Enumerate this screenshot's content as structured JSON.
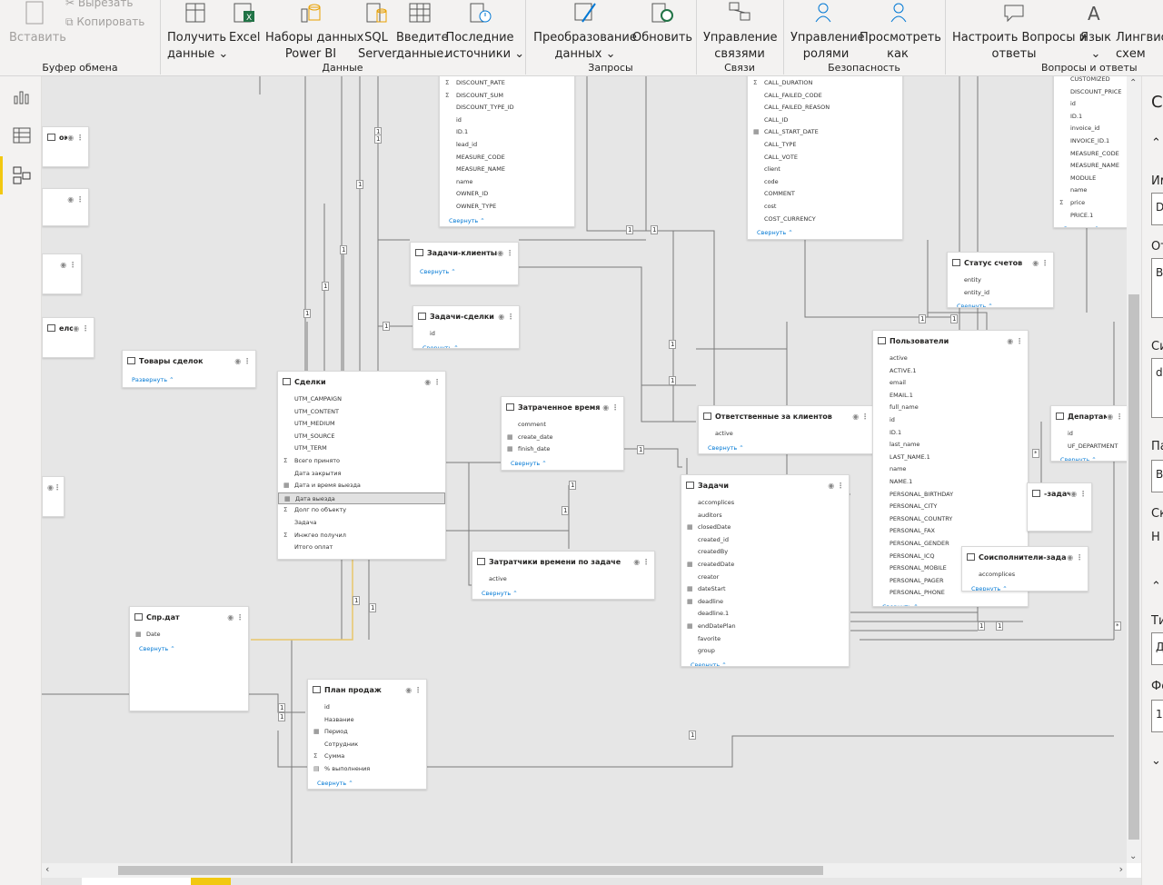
{
  "ribbon": {
    "clipboard": {
      "cut": "Вырезать",
      "copy": "Копировать",
      "paste": "Вставить",
      "group": "Буфер обмена"
    },
    "data": {
      "get_data": "Получить",
      "get_data2": "данные",
      "excel": "Excel",
      "datasets": "Наборы данных",
      "datasets2": "Power BI",
      "sql": "SQL",
      "sql2": "Server",
      "enter": "Введите",
      "enter2": "данные.",
      "recent": "Последние",
      "recent2": "источники",
      "group": "Данные"
    },
    "queries": {
      "transform": "Преобразование",
      "transform2": "данных",
      "refresh": "Обновить",
      "group": "Запросы"
    },
    "relations": {
      "manage": "Управление",
      "manage2": "связями",
      "group": "Связи"
    },
    "security": {
      "roles": "Управление",
      "roles2": "ролями",
      "view": "Просмотреть",
      "view2": "как",
      "group": "Безопасность"
    },
    "qa": {
      "setup": "Настроить Вопросы и",
      "setup2": "ответы",
      "lang": "Язык",
      "lang2": "",
      "ling": "Лингвис",
      "ling2": "схем",
      "group": "Вопросы и ответы"
    }
  },
  "tables": [
    {
      "id": "discount",
      "title": "",
      "fields": [
        "DISCOUNT_RATE",
        "DISCOUNT_SUM",
        "DISCOUNT_TYPE_ID",
        "id",
        "ID.1",
        "lead_id",
        "MEASURE_CODE",
        "MEASURE_NAME",
        "name",
        "OWNER_ID",
        "OWNER_TYPE"
      ],
      "icons": [
        "Σ",
        "Σ",
        "",
        "",
        "",
        "",
        "",
        "",
        "",
        "",
        ""
      ],
      "collapse": "Свернуть"
    },
    {
      "id": "calls",
      "title": "",
      "fields": [
        "CALL_DURATION",
        "CALL_FAILED_CODE",
        "CALL_FAILED_REASON",
        "CALL_ID",
        "CALL_START_DATE",
        "CALL_TYPE",
        "CALL_VOTE",
        "client",
        "code",
        "COMMENT",
        "cost",
        "COST_CURRENCY"
      ],
      "icons": [
        "Σ",
        "",
        "",
        "",
        "▦",
        "",
        "",
        "",
        "",
        "",
        "",
        ""
      ],
      "collapse": "Свернуть"
    },
    {
      "id": "products",
      "title": "",
      "fields": [
        "CUSTOMIZED",
        "DISCOUNT_PRICE",
        "id",
        "ID.1",
        "invoice_id",
        "INVOICE_ID.1",
        "MEASURE_CODE",
        "MEASURE_NAME",
        "MODULE",
        "name",
        "price",
        "PRICE.1"
      ],
      "icons": [
        "",
        "",
        "",
        "",
        "",
        "",
        "",
        "",
        "",
        "",
        "Σ",
        ""
      ],
      "collapse": "Свернуть"
    },
    {
      "id": "tasks_clients",
      "title": "Задачи-клиенты",
      "fields": [],
      "icons": [],
      "collapse": "Свернуть"
    },
    {
      "id": "tasks_deals",
      "title": "Задачи-сделки",
      "fields": [
        "id"
      ],
      "icons": [
        ""
      ],
      "collapse": "Свернуть"
    },
    {
      "id": "status",
      "title": "Статус счетов",
      "fields": [
        "entity",
        "entity_id"
      ],
      "icons": [
        "",
        ""
      ],
      "collapse": "Свернуть"
    },
    {
      "id": "deal_goods",
      "title": "Товары сделок",
      "fields": [],
      "icons": [],
      "collapse": "Развернуть"
    },
    {
      "id": "deals",
      "title": "Сделки",
      "fields": [
        "UTM_CAMPAIGN",
        "UTM_CONTENT",
        "UTM_MEDIUM",
        "UTM_SOURCE",
        "UTM_TERM",
        "Всего принято",
        "Дата закрытия",
        "Дата и время выезда",
        "Дата выезда",
        "Долг по объекту",
        "Задача",
        "Инжгео получил",
        "Итого оплат"
      ],
      "icons": [
        "",
        "",
        "",
        "",
        "",
        "Σ",
        "",
        "▦",
        "▦",
        "Σ",
        "",
        "Σ",
        ""
      ],
      "selected": 8,
      "collapse": "Свернуть"
    },
    {
      "id": "time_spent",
      "title": "Затраченное время",
      "fields": [
        "comment",
        "create_date",
        "finish_date"
      ],
      "icons": [
        "",
        "▦",
        "▦"
      ],
      "collapse": "Свернуть"
    },
    {
      "id": "responsible",
      "title": "Ответственные за клиентов",
      "fields": [
        "active"
      ],
      "icons": [
        ""
      ],
      "collapse": "Свернуть"
    },
    {
      "id": "users",
      "title": "Пользователи",
      "fields": [
        "active",
        "ACTIVE.1",
        "email",
        "EMAIL.1",
        "full_name",
        "id",
        "ID.1",
        "last_name",
        "LAST_NAME.1",
        "name",
        "NAME.1",
        "PERSONAL_BIRTHDAY",
        "PERSONAL_CITY",
        "PERSONAL_COUNTRY",
        "PERSONAL_FAX",
        "PERSONAL_GENDER",
        "PERSONAL_ICQ",
        "PERSONAL_MOBILE",
        "PERSONAL_PAGER",
        "PERSONAL_PHONE"
      ],
      "icons": [
        "",
        "",
        "",
        "",
        "",
        "",
        "",
        "",
        "",
        "",
        "",
        "",
        "",
        "",
        "",
        "",
        "",
        "",
        "",
        ""
      ],
      "collapse": "Свернуть"
    },
    {
      "id": "dept",
      "title": "Департамент-пол",
      "fields": [
        "id",
        "UF_DEPARTMENT"
      ],
      "icons": [
        "",
        ""
      ],
      "collapse": "Свернуть"
    },
    {
      "id": "tasks",
      "title": "Задачи",
      "fields": [
        "accomplices",
        "auditors",
        "closedDate",
        "created_id",
        "createdBy",
        "createdDate",
        "creator",
        "dateStart",
        "deadline",
        "deadline.1",
        "endDatePlan",
        "favorite",
        "group"
      ],
      "icons": [
        "",
        "",
        "▦",
        "",
        "",
        "▦",
        "",
        "▦",
        "▦",
        "",
        "▦",
        "",
        ""
      ],
      "collapse": "Свернуть"
    },
    {
      "id": "task_time",
      "title": "Затратчики времени по задаче",
      "fields": [
        "active"
      ],
      "icons": [
        ""
      ],
      "collapse": "Свернуть"
    },
    {
      "id": "coexec",
      "title": "Соисполнители-задачи",
      "fields": [
        "accomplices"
      ],
      "icons": [
        ""
      ],
      "collapse": "Свернуть"
    },
    {
      "id": "tasks2",
      "title": "-задачи",
      "fields": [],
      "icons": [],
      "collapse": ""
    },
    {
      "id": "dates",
      "title": "Спр.дат",
      "fields": [
        "Date"
      ],
      "icons": [
        "▦"
      ],
      "collapse": "Свернуть"
    },
    {
      "id": "plan",
      "title": "План продаж",
      "fields": [
        "id",
        "Название",
        "Период",
        "Сотрудник",
        "Сумма",
        "% выполнения"
      ],
      "icons": [
        "",
        "",
        "▦",
        "",
        "Σ",
        "▤"
      ],
      "collapse": "Свернуть"
    },
    {
      "id": "left1",
      "title": "ок",
      "fields": [],
      "icons": [],
      "collapse": ""
    },
    {
      "id": "left4",
      "title": "елок",
      "fields": [],
      "icons": [],
      "collapse": ""
    }
  ],
  "right_panel": {
    "labels": [
      "С",
      "Им",
      "D",
      "От",
      "В",
      "Си",
      "d",
      "Па",
      "В",
      "Ск",
      "Н",
      "Ти",
      "Д",
      "Фо",
      "1"
    ]
  },
  "badges": [
    "1",
    "1",
    "1",
    "1",
    "1",
    "1",
    "1",
    "1",
    "1",
    "1",
    "1",
    "1",
    "1",
    "1",
    "1",
    "1",
    "1",
    "1",
    "1",
    "1",
    "1",
    "1",
    "1",
    "*",
    "*"
  ]
}
